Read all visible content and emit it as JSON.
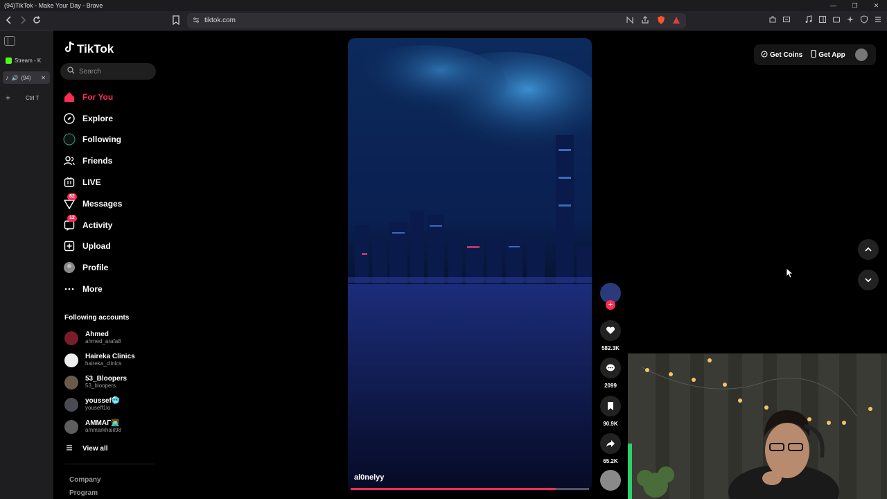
{
  "window": {
    "title": "(94)TikTok - Make Your Day - Brave",
    "min": "—",
    "max": "❐",
    "close": "✕"
  },
  "browser": {
    "url": "tiktok.com"
  },
  "browser_sidebar": {
    "tabs": [
      {
        "label": "Stream - K"
      },
      {
        "label": "(94)",
        "close": "✕"
      }
    ],
    "new_tab_label": "+",
    "shortcut": "Ctrl  T"
  },
  "app": {
    "logo_text": "TikTok",
    "search_placeholder": "Search",
    "nav": [
      {
        "label": "For You"
      },
      {
        "label": "Explore"
      },
      {
        "label": "Following"
      },
      {
        "label": "Friends"
      },
      {
        "label": "LIVE"
      },
      {
        "label": "Messages",
        "badge": "82"
      },
      {
        "label": "Activity",
        "badge": "12"
      },
      {
        "label": "Upload"
      },
      {
        "label": "Profile"
      },
      {
        "label": "More"
      }
    ],
    "following_title": "Following accounts",
    "accounts": [
      {
        "name": "Ahmed",
        "handle": "ahmed_arafa8"
      },
      {
        "name": "Haireka Clinics",
        "handle": "haireka_clinics"
      },
      {
        "name": "53_Bloopers",
        "handle": "53_bloopers"
      },
      {
        "name": "youssef🥶",
        "handle": "youseff1lo"
      },
      {
        "name": "AMMAΓ👨‍💻",
        "handle": "ammarkhalil98"
      }
    ],
    "view_all": "View all",
    "footer": [
      "Company",
      "Program"
    ]
  },
  "video": {
    "author": "al0nelyy",
    "progress": 0.86,
    "likes": "582.3K",
    "comments": "2099",
    "saves": "90.9K",
    "shares": "65.2K"
  },
  "top_right": {
    "coins": "Get Coins",
    "app": "Get App"
  },
  "colors": {
    "accent": "#fe2c55"
  }
}
